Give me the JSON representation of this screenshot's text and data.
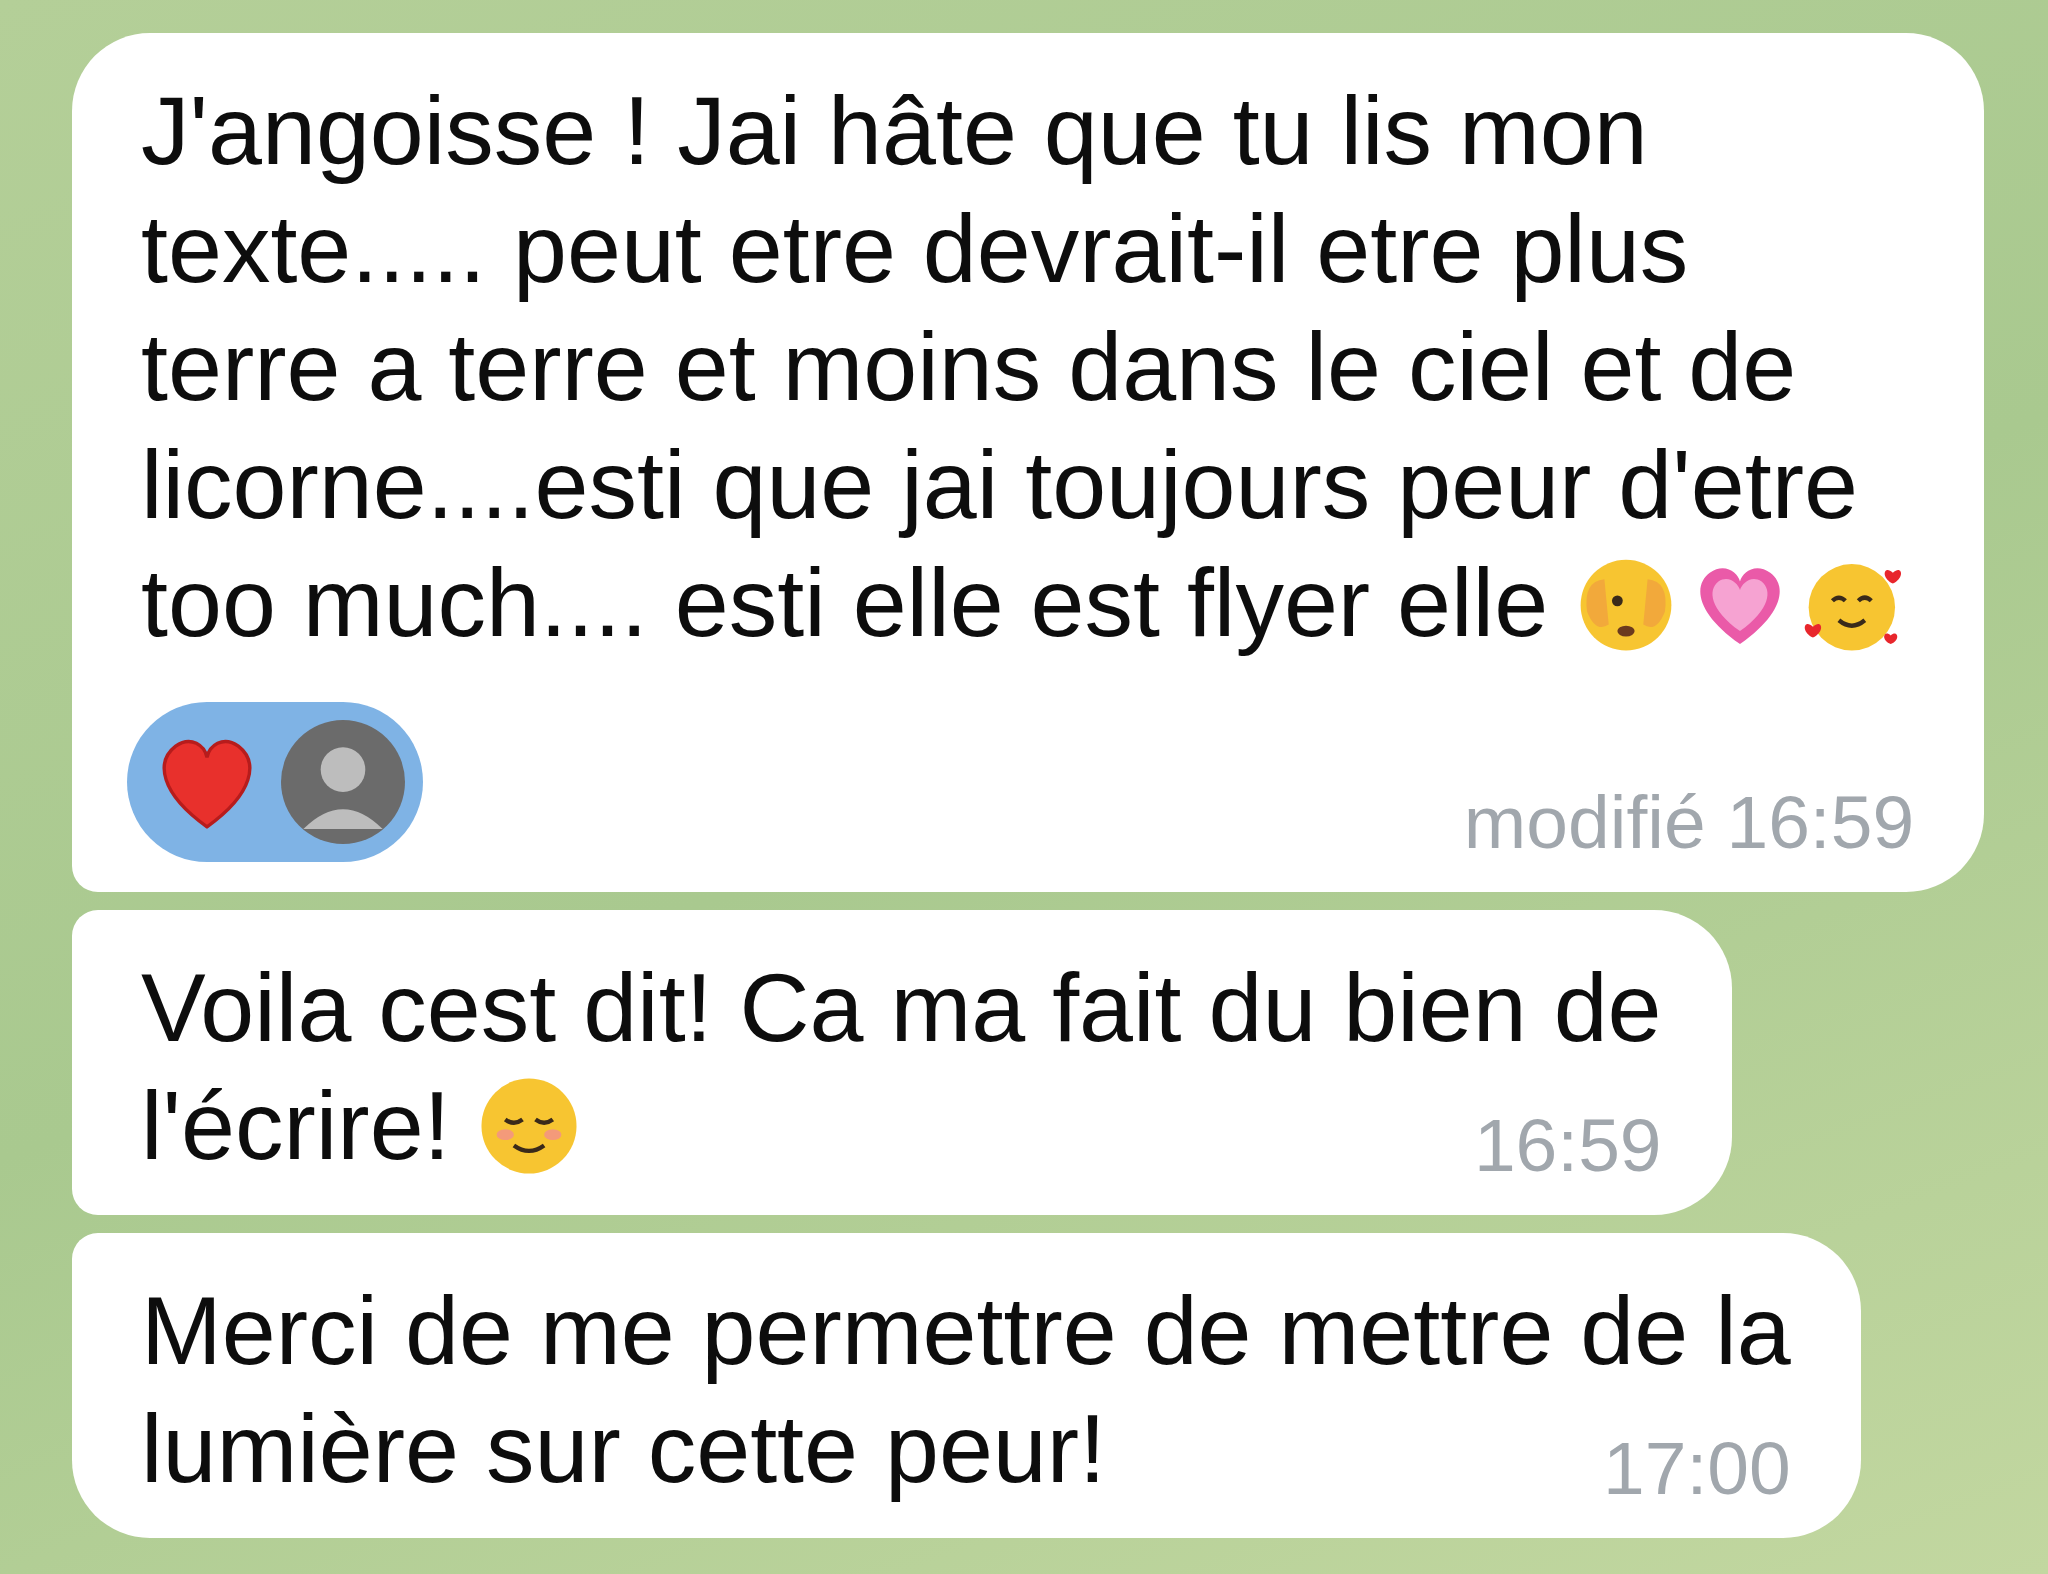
{
  "messages": [
    {
      "lines": [
        "J'angoisse ! Jai hâte que tu lis mon",
        "texte..... peut etre devrait-il etre plus",
        "terre a terre et moins dans le ciel et de",
        "licorne....esti que jai toujours peur d'etre",
        "too much.... esti elle est flyer elle"
      ],
      "emojis": [
        {
          "kind": "peeking-face"
        },
        {
          "kind": "pink-heart"
        },
        {
          "kind": "hearts-face"
        }
      ],
      "reactions": [
        {
          "kind": "heart",
          "selected": true
        }
      ],
      "time": "modifié 16:59"
    },
    {
      "lines": [
        "Voila cest dit! Ca ma fait du bien de",
        "l'écrire!"
      ],
      "emojis": [
        {
          "kind": "smiling-face"
        }
      ],
      "time": "16:59"
    },
    {
      "lines": [
        "Merci de me permettre de mettre de la",
        "lumière sur cette peur!"
      ],
      "time": "17:00"
    }
  ]
}
